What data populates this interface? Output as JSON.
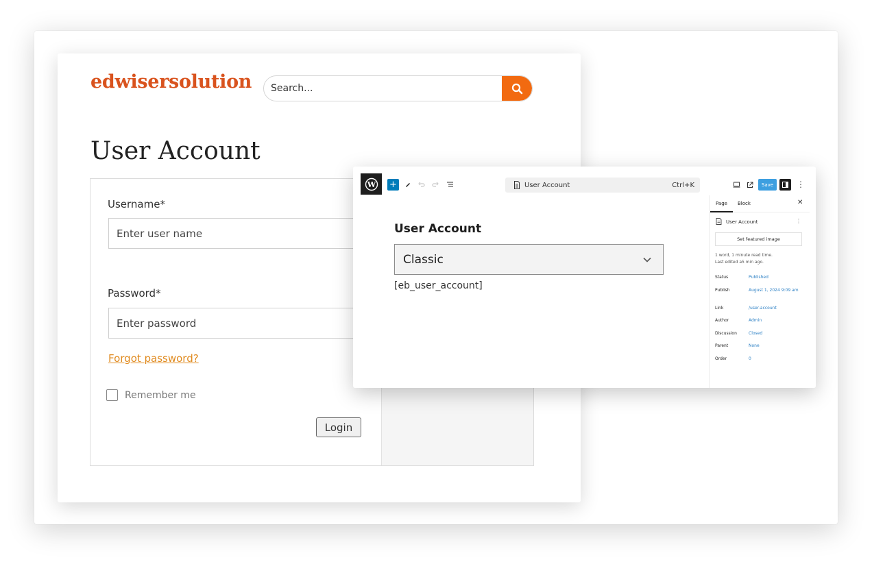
{
  "site": {
    "logo": "edwisersolution",
    "search_placeholder": "Search...",
    "page_title": "User Account",
    "form": {
      "username_label": "Username*",
      "username_placeholder": "Enter user name",
      "password_label": "Password*",
      "password_placeholder": "Enter password",
      "forgot_link": "Forgot password?",
      "remember_label": "Remember me",
      "login_button": "Login"
    },
    "colors": {
      "brand": "#d9531e",
      "search_button": "#f26a10",
      "link": "#e08a1e"
    }
  },
  "editor": {
    "toolbar": {
      "icons": [
        "wordpress-icon",
        "add-block-icon",
        "pen-icon",
        "undo-icon",
        "redo-icon",
        "list-view-icon",
        "document-icon",
        "desktop-preview-icon",
        "external-link-icon",
        "settings-panel-icon",
        "kebab-icon"
      ],
      "doc_title": "User Account",
      "shortcut": "Ctrl+K",
      "save_label": "Save"
    },
    "canvas": {
      "heading": "User Account",
      "select_value": "Classic",
      "shortcode": "[eb_user_account]"
    },
    "sidebar": {
      "tabs": [
        "Page",
        "Block"
      ],
      "page_title": "User Account",
      "featured_image_button": "Set featured image",
      "meta_line1": "1 word, 1 minute read time.",
      "meta_line2": "Last edited a5 min ago.",
      "rows": [
        {
          "label": "Status",
          "value": "Published"
        },
        {
          "label": "Publish",
          "value": "August 1, 2024 9:09 am"
        },
        {
          "label": "Link",
          "value": "/user-account"
        },
        {
          "label": "Author",
          "value": "Admin"
        },
        {
          "label": "Discussion",
          "value": "Closed"
        },
        {
          "label": "Parent",
          "value": "None"
        },
        {
          "label": "Order",
          "value": "0"
        }
      ]
    },
    "colors": {
      "accent": "#007cba",
      "save": "#3d9fe0",
      "sidebar_value": "#2a7fc4"
    }
  }
}
